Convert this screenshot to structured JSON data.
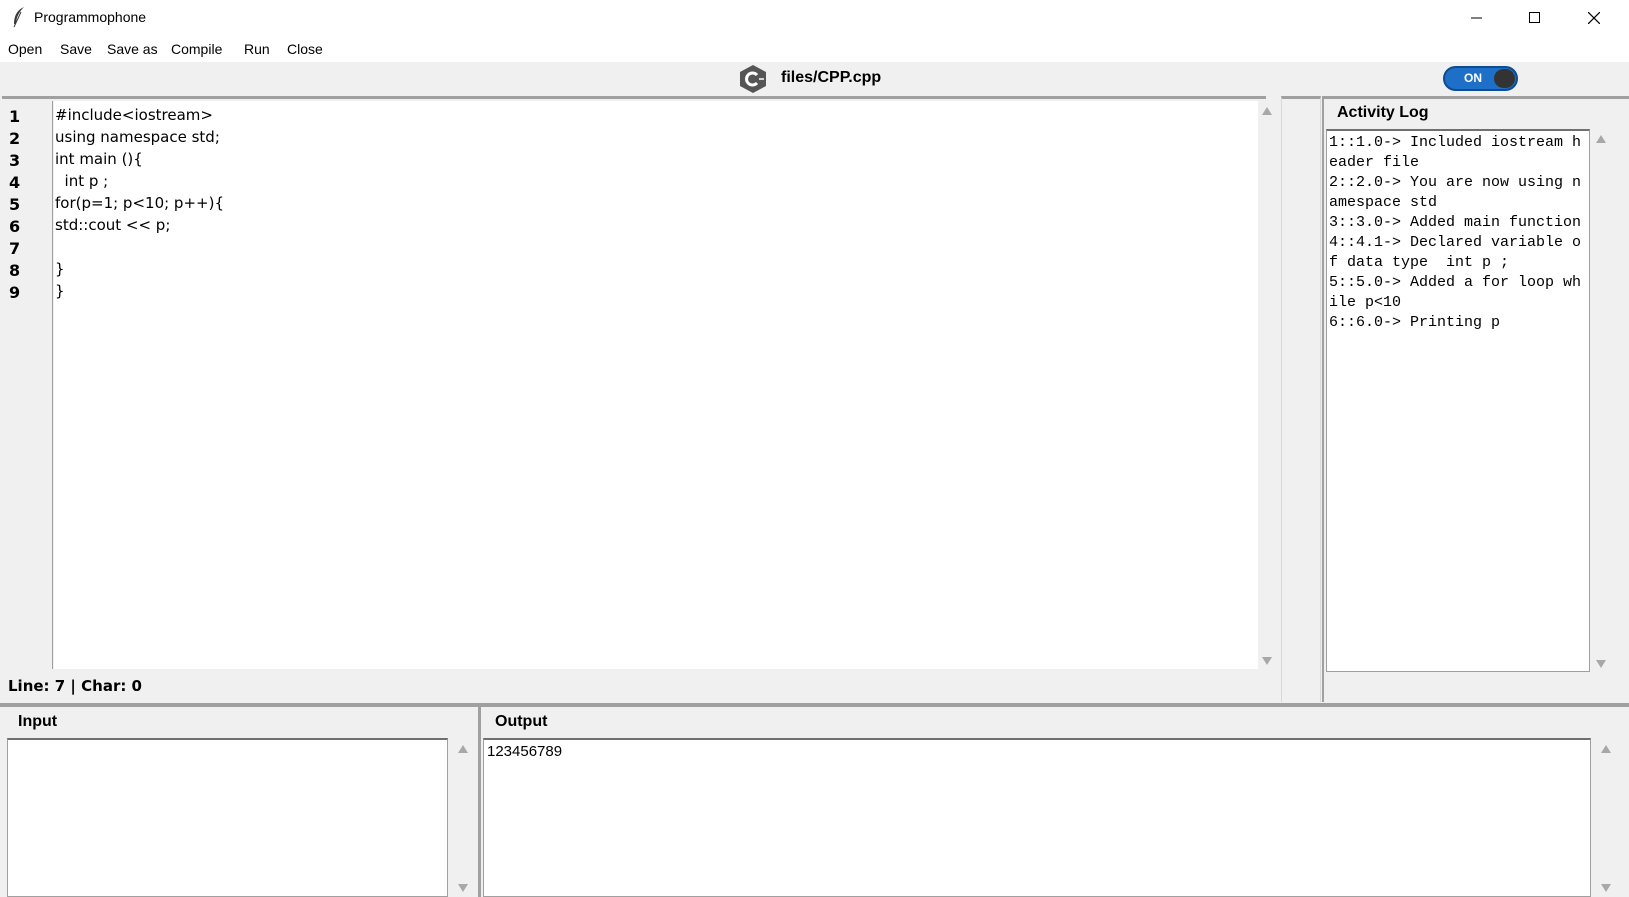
{
  "window": {
    "title": "Programmophone"
  },
  "menu": [
    "Open",
    "Save",
    "Save as",
    "Compile",
    "Run",
    "Close"
  ],
  "header": {
    "file_name": "files/CPP.cpp",
    "toggle_label": "ON"
  },
  "editor": {
    "line_numbers": [
      "1",
      "2",
      "3",
      "4",
      "5",
      "6",
      "7",
      "8",
      "9"
    ],
    "lines": [
      "#include<iostream>",
      "using namespace std;",
      "int main (){",
      "  int p ;",
      "for(p=1; p<10; p++){",
      "std::cout << p;",
      "",
      "}",
      "}"
    ],
    "status": "Line: 7 | Char: 0"
  },
  "activity_log": {
    "title": "Activity Log",
    "entries": [
      "1::1.0-> Included iostream header file",
      "2::2.0-> You are now using namespace std",
      "3::3.0-> Added main function",
      "4::4.1-> Declared variable of data type  int p ;\n",
      "5::5.0-> Added a for loop while p<10",
      "6::6.0-> Printing p"
    ]
  },
  "input_panel": {
    "title": "Input",
    "value": ""
  },
  "output_panel": {
    "title": "Output",
    "value": "123456789"
  },
  "colors": {
    "toggle_on": "#1d6fc7",
    "panel_bg": "#f0f0f0"
  }
}
